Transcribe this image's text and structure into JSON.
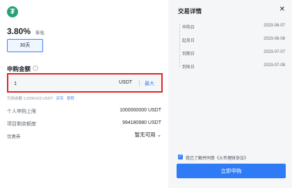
{
  "coin": {
    "symbol": "₮",
    "icon": "tether-icon",
    "color": "#26a17b"
  },
  "product": {
    "rate": "3.80%",
    "rate_unit": "年化",
    "term": "30天"
  },
  "amount": {
    "title": "申购金额",
    "info": "i",
    "input_value": "1",
    "unit": "USDT",
    "max_label": "最大",
    "available": "可用余额 1.0290163 USDT",
    "buy_label": "买币",
    "transfer_label": "划转"
  },
  "limits": {
    "personal_label": "个人申购上限",
    "personal_value": "1000000000 USDT",
    "remaining_label": "项目剩余额度",
    "remaining_value": "994180980 USDT"
  },
  "coupon": {
    "label": "优惠券",
    "value": "暂无可用",
    "chevron": "⌄"
  },
  "details": {
    "title": "交易详情",
    "close": "✕",
    "timeline": [
      {
        "label": "申购日",
        "date": "2023-06-07"
      },
      {
        "label": "起息日",
        "date": "2023-06-08"
      },
      {
        "label": "到期日",
        "date": "2023-07-07"
      },
      {
        "label": "到账日",
        "date": "2023-07-08"
      }
    ]
  },
  "agreement": {
    "checked": "✓",
    "text": "我已了解并同意《火币理财协议》"
  },
  "submit_label": "立即申购",
  "colors": {
    "accent": "#2f7bf5",
    "highlight_border": "#e02424"
  }
}
